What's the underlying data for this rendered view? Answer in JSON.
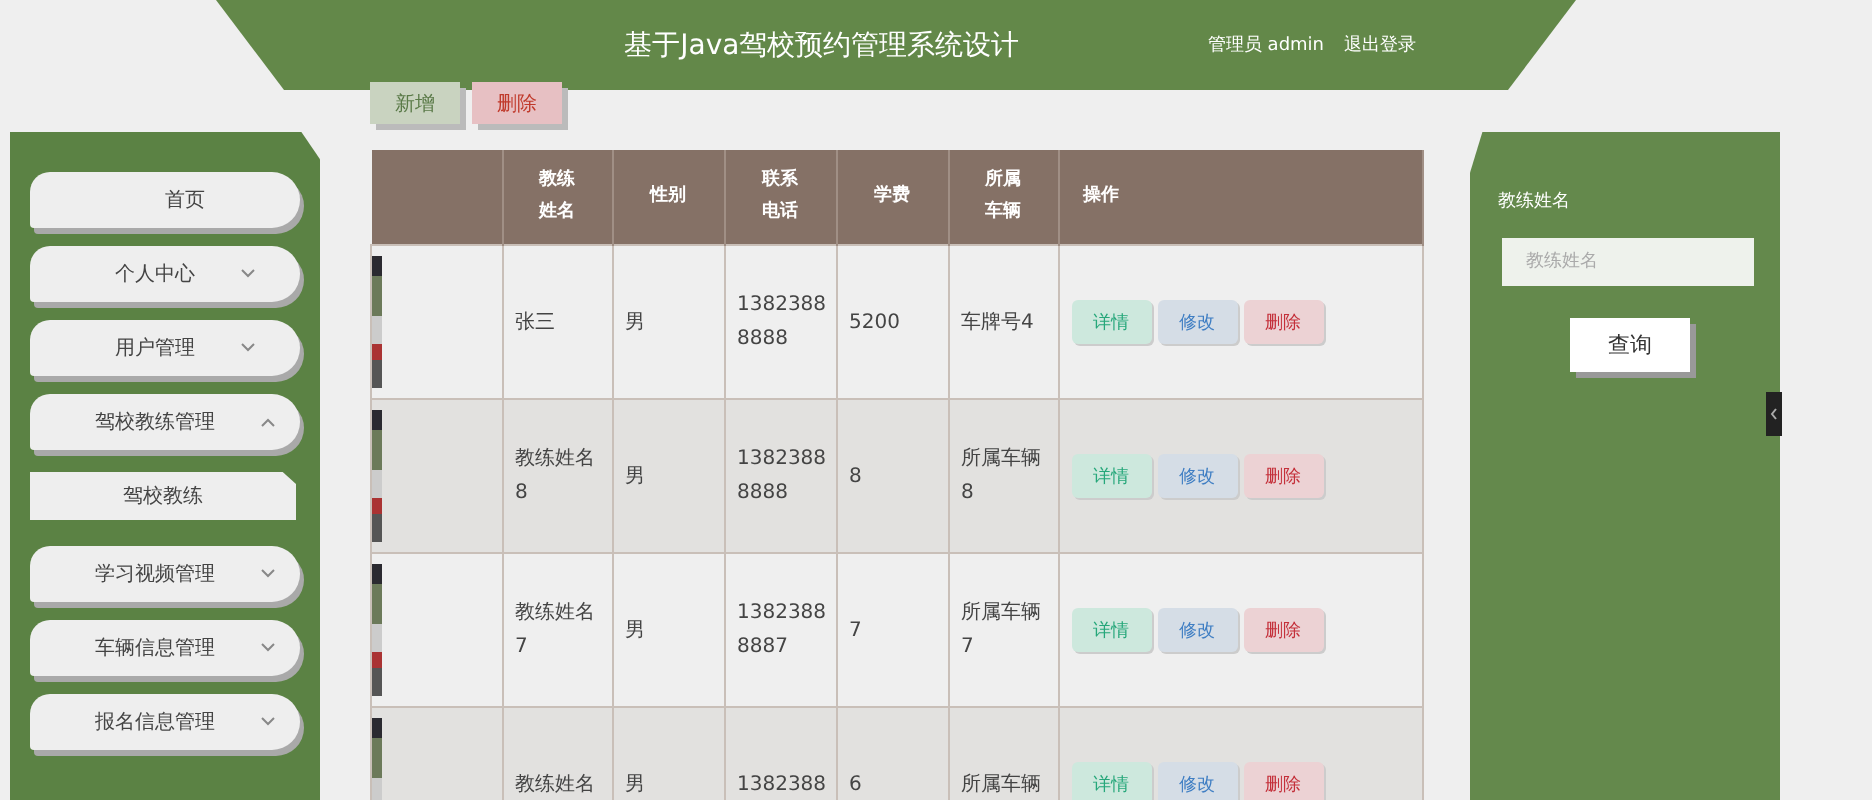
{
  "header": {
    "title": "基于Java驾校预约管理系统设计",
    "user": "管理员 admin",
    "logout": "退出登录"
  },
  "toolbar": {
    "buttons": [
      {
        "label": "新增",
        "kind": "add"
      },
      {
        "label": "删除",
        "kind": "delete"
      }
    ]
  },
  "sidebar": {
    "items": [
      {
        "label": "首页"
      },
      {
        "label": "个人中心",
        "expanded": false
      },
      {
        "label": "用户管理",
        "expanded": false
      },
      {
        "label": "驾校教练管理",
        "expanded": true,
        "children": [
          {
            "label": "驾校教练"
          }
        ]
      },
      {
        "label": "学习视频管理",
        "expanded": false
      },
      {
        "label": "车辆信息管理",
        "expanded": false
      },
      {
        "label": "报名信息管理",
        "expanded": false
      }
    ]
  },
  "table": {
    "columns": [
      "",
      "教练姓名",
      "性别",
      "联系电话",
      "学费",
      "所属车辆",
      "操作"
    ],
    "rows": [
      {
        "name": "张三",
        "gender": "男",
        "phone": "1382388\n8888",
        "fee": "5200",
        "vehicle": "车牌号4",
        "actions": [
          "详情",
          "修改",
          "删除"
        ]
      },
      {
        "name": "教练姓名\n8",
        "gender": "男",
        "phone": "1382388\n8888",
        "fee": "8",
        "vehicle": "所属车辆\n8",
        "actions": [
          "详情",
          "修改",
          "删除"
        ]
      },
      {
        "name": "教练姓名\n7",
        "gender": "男",
        "phone": "1382388\n8887",
        "fee": "7",
        "vehicle": "所属车辆\n7",
        "actions": [
          "详情",
          "修改",
          "删除"
        ]
      },
      {
        "name": "教练姓名",
        "gender": "男",
        "phone": "1382388",
        "fee": "6",
        "vehicle": "所属车辆",
        "actions": [
          "详情",
          "修改",
          "删除"
        ]
      }
    ]
  },
  "search": {
    "label": "教练姓名",
    "placeholder": "教练姓名",
    "button": "查询"
  }
}
